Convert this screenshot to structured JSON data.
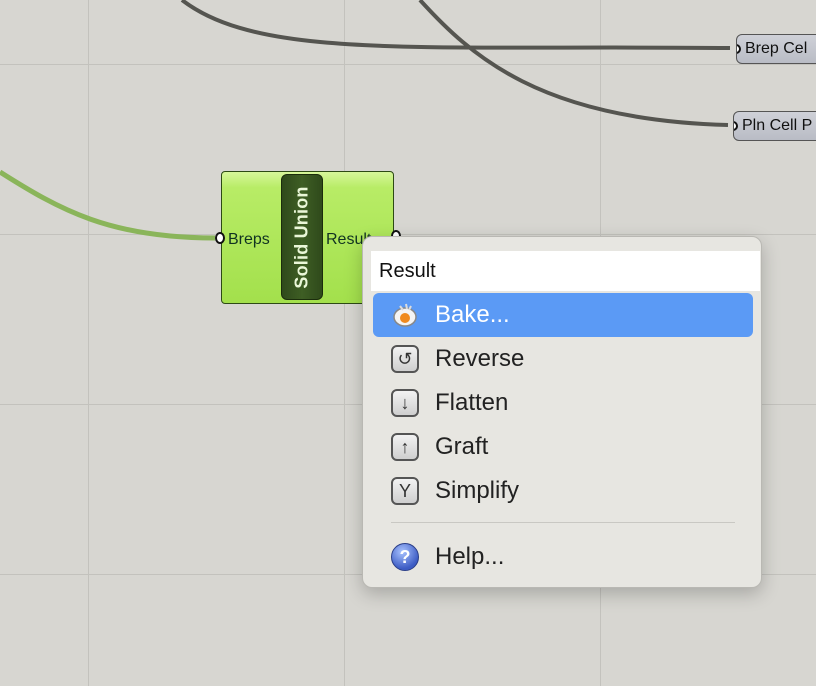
{
  "parameters": {
    "brep": {
      "label": "Brep Cel"
    },
    "pln": {
      "label": "Pln Cell P"
    }
  },
  "component": {
    "title": "Solid Union",
    "input_label": "Breps",
    "output_label": "Result"
  },
  "context_menu": {
    "header": "Result",
    "items": [
      {
        "label": "Bake...",
        "icon": "bake-icon",
        "selected": true
      },
      {
        "label": "Reverse",
        "icon": "reverse-icon"
      },
      {
        "label": "Flatten",
        "icon": "flatten-icon"
      },
      {
        "label": "Graft",
        "icon": "graft-icon"
      },
      {
        "label": "Simplify",
        "icon": "simplify-icon"
      },
      {
        "label": "Help...",
        "icon": "help-icon"
      }
    ]
  },
  "colors": {
    "canvas": "#d7d6d1",
    "wire_dark": "#555550",
    "wire_green": "#8ab55a",
    "component_green": "#a3e04c",
    "menu_highlight": "#5b9af5"
  }
}
